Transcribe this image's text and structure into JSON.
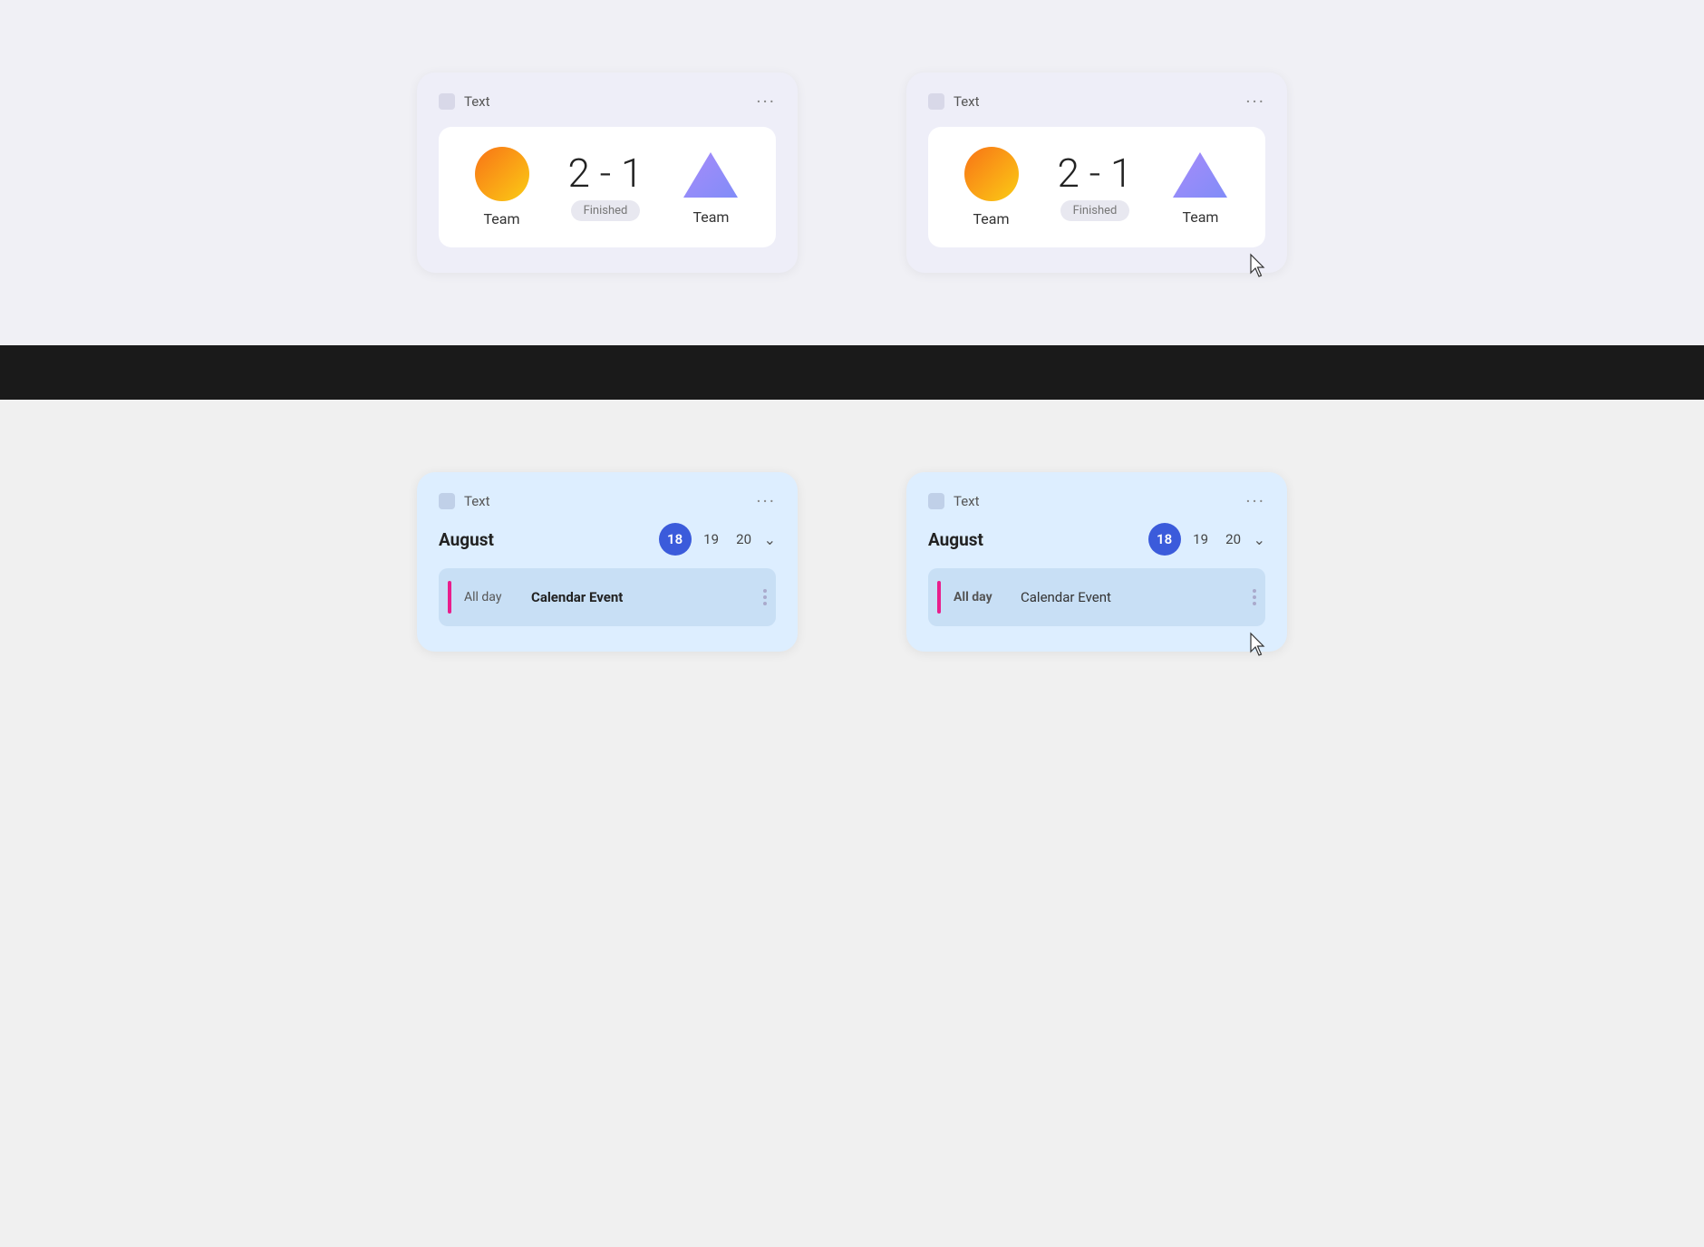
{
  "cards": {
    "score_card_1": {
      "title": "Text",
      "menu": "···",
      "team1_label": "Team",
      "score": "2 - 1",
      "status": "Finished",
      "team2_label": "Team"
    },
    "score_card_2": {
      "title": "Text",
      "menu": "···",
      "team1_label": "Team",
      "score": "2 - 1",
      "status": "Finished",
      "team2_label": "Team"
    },
    "cal_card_1": {
      "title": "Text",
      "menu": "···",
      "month": "August",
      "day_active": "18",
      "day2": "19",
      "day3": "20",
      "allday": "All day",
      "event": "Calendar Event"
    },
    "cal_card_2": {
      "title": "Text",
      "menu": "···",
      "month": "August",
      "day_active": "18",
      "day2": "19",
      "day3": "20",
      "allday": "All day",
      "event": "Calendar Event"
    }
  }
}
